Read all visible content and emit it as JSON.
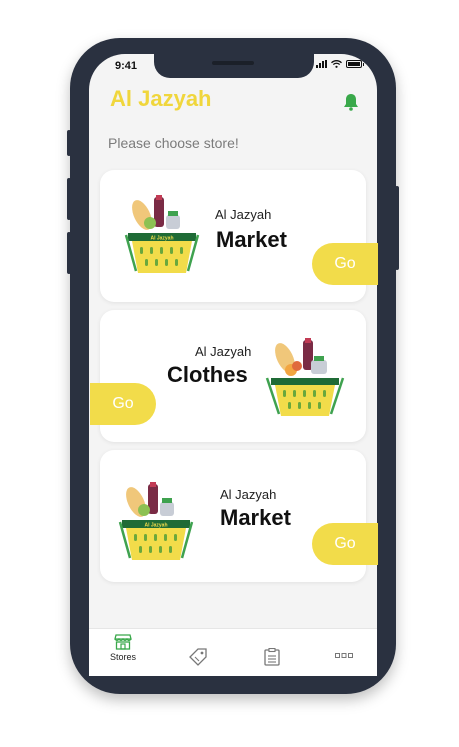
{
  "status_bar": {
    "time": "9:41"
  },
  "header": {
    "logo_text": "Al Jazyah"
  },
  "prompt": "Please choose store!",
  "stores": [
    {
      "label": "Al Jazyah",
      "title": "Market",
      "button": "Go",
      "basket_tag": "Al Jazyah"
    },
    {
      "label": "Al Jazyah",
      "title": "Clothes",
      "button": "Go",
      "basket_tag": ""
    },
    {
      "label": "Al Jazyah",
      "title": "Market",
      "button": "Go",
      "basket_tag": "Al Jazyah"
    }
  ],
  "tabbar": {
    "items": [
      {
        "icon": "store-icon",
        "label": "Stores",
        "active": true
      },
      {
        "icon": "tag-icon",
        "label": ""
      },
      {
        "icon": "list-icon",
        "label": ""
      },
      {
        "icon": "more-icon",
        "label": ""
      }
    ]
  },
  "colors": {
    "accent": "#f2dc4a",
    "active_tab": "#39a84a",
    "phone_frame": "#2a3140"
  }
}
